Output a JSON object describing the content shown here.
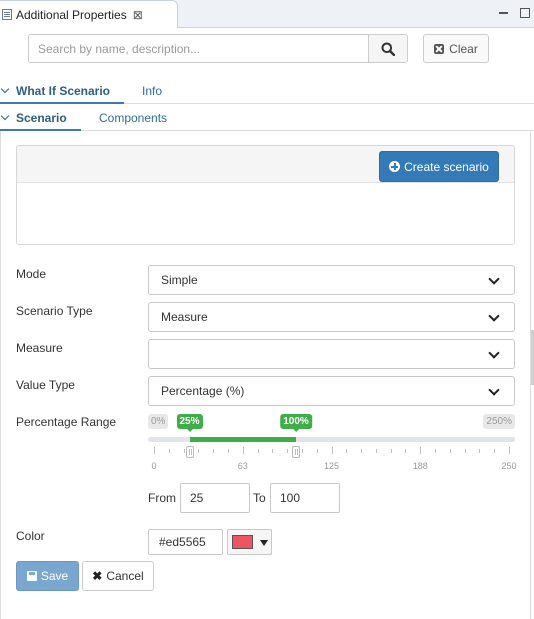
{
  "view_tab": {
    "title": "Additional Properties",
    "close_glyph": "⊠"
  },
  "search": {
    "placeholder": "Search by name, description...",
    "value": "",
    "clear_label": "Clear"
  },
  "tabs_level1": [
    {
      "label": "What If Scenario",
      "active": true
    },
    {
      "label": "Info",
      "active": false
    }
  ],
  "tabs_level2": [
    {
      "label": "Scenario",
      "active": true
    },
    {
      "label": "Components",
      "active": false
    }
  ],
  "scenario_panel": {
    "create_label": "Create scenario"
  },
  "form": {
    "mode": {
      "label": "Mode",
      "value": "Simple"
    },
    "scenario_type": {
      "label": "Scenario Type",
      "value": "Measure"
    },
    "measure": {
      "label": "Measure",
      "value": ""
    },
    "value_type": {
      "label": "Value Type",
      "value": "Percentage (%)"
    },
    "percentage_range": {
      "label": "Percentage Range",
      "min": 0,
      "max": 250,
      "min_label": "0%",
      "max_label": "250%",
      "from": 25,
      "to": 100,
      "from_label": "25%",
      "to_label": "100%",
      "tick_labels": [
        "0",
        "63",
        "125",
        "188",
        "250"
      ]
    },
    "from_label": "From",
    "to_label": "To",
    "from_value": "25",
    "to_value": "100",
    "color": {
      "label": "Color",
      "value": "#ed5565"
    }
  },
  "actions": {
    "save_label": "Save",
    "cancel_label": "Cancel"
  },
  "colors": {
    "accent": "#337ab7",
    "range_green": "#3fae49",
    "swatch": "#ed5565"
  }
}
